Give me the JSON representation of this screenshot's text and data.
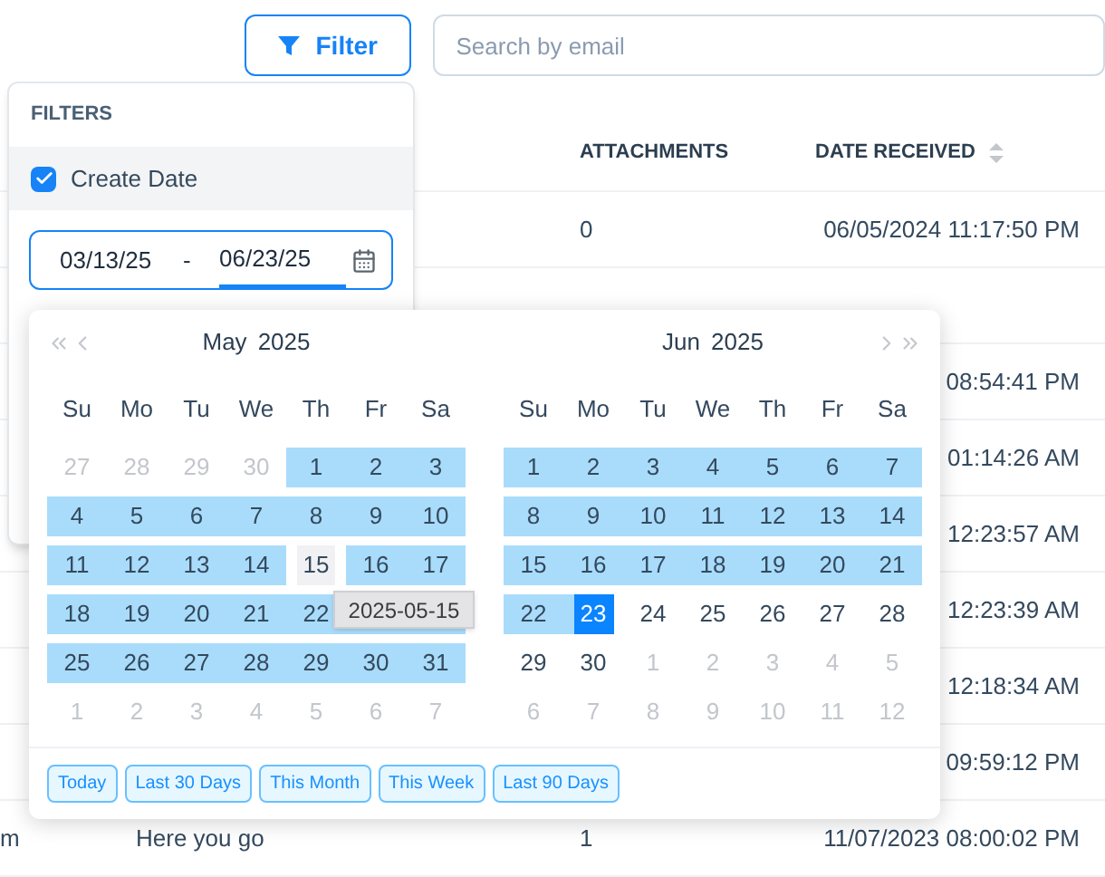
{
  "toolbar": {
    "filter_button": "Filter",
    "search": {
      "placeholder": "Search by email"
    }
  },
  "table": {
    "columns": [
      {
        "label": "ATTACHMENTS",
        "sortable": false
      },
      {
        "label": "DATE RECEIVED",
        "sortable": true
      }
    ],
    "rows": [
      {
        "attachments": "0",
        "date_received": "06/05/2024 11:17:50 PM"
      },
      {},
      {
        "date_received": "08:54:41 PM"
      },
      {
        "date_received": "01:14:26 AM"
      },
      {
        "date_received": "12:23:57 AM"
      },
      {
        "date_received": "12:23:39 AM"
      },
      {
        "date_received": "12:18:34 AM"
      },
      {
        "date_received": "09:59:12 PM"
      },
      {
        "column_1": "m",
        "column_2": "Here you go",
        "attachments": "1",
        "date_received": "11/07/2023 08:00:02 PM"
      }
    ]
  },
  "filters": {
    "title": "FILTERS",
    "options": [
      {
        "label": "Create Date",
        "checked": true
      }
    ],
    "date_range": {
      "start": "03/13/25",
      "separator": "-",
      "end": "06/23/25",
      "end_focused": true
    }
  },
  "calendar": {
    "months": [
      {
        "month": "May",
        "year": "2025",
        "weekdays": [
          "Su",
          "Mo",
          "Tu",
          "We",
          "Th",
          "Fr",
          "Sa"
        ],
        "weeks": [
          [
            {
              "day": "27",
              "kind": "outside"
            },
            {
              "day": "28",
              "kind": "outside"
            },
            {
              "day": "29",
              "kind": "outside"
            },
            {
              "day": "30",
              "kind": "outside"
            },
            {
              "day": "1",
              "kind": "range"
            },
            {
              "day": "2",
              "kind": "range"
            },
            {
              "day": "3",
              "kind": "range"
            }
          ],
          [
            {
              "day": "4",
              "kind": "range"
            },
            {
              "day": "5",
              "kind": "range"
            },
            {
              "day": "6",
              "kind": "range"
            },
            {
              "day": "7",
              "kind": "range"
            },
            {
              "day": "8",
              "kind": "range"
            },
            {
              "day": "9",
              "kind": "range"
            },
            {
              "day": "10",
              "kind": "range"
            }
          ],
          [
            {
              "day": "11",
              "kind": "range"
            },
            {
              "day": "12",
              "kind": "range"
            },
            {
              "day": "13",
              "kind": "range"
            },
            {
              "day": "14",
              "kind": "range"
            },
            {
              "day": "15",
              "kind": "hover"
            },
            {
              "day": "16",
              "kind": "range"
            },
            {
              "day": "17",
              "kind": "range"
            }
          ],
          [
            {
              "day": "18",
              "kind": "range"
            },
            {
              "day": "19",
              "kind": "range"
            },
            {
              "day": "20",
              "kind": "range"
            },
            {
              "day": "21",
              "kind": "range"
            },
            {
              "day": "22",
              "kind": "range"
            },
            {
              "kind": "range"
            },
            {
              "kind": "range"
            }
          ],
          [
            {
              "day": "25",
              "kind": "range"
            },
            {
              "day": "26",
              "kind": "range"
            },
            {
              "day": "27",
              "kind": "range"
            },
            {
              "day": "28",
              "kind": "range"
            },
            {
              "day": "29",
              "kind": "range"
            },
            {
              "day": "30",
              "kind": "range"
            },
            {
              "day": "31",
              "kind": "range"
            }
          ],
          [
            {
              "day": "1",
              "kind": "outside"
            },
            {
              "day": "2",
              "kind": "outside"
            },
            {
              "day": "3",
              "kind": "outside"
            },
            {
              "day": "4",
              "kind": "outside"
            },
            {
              "day": "5",
              "kind": "outside"
            },
            {
              "day": "6",
              "kind": "outside"
            },
            {
              "day": "7",
              "kind": "outside"
            }
          ]
        ]
      },
      {
        "month": "Jun",
        "year": "2025",
        "weekdays": [
          "Su",
          "Mo",
          "Tu",
          "We",
          "Th",
          "Fr",
          "Sa"
        ],
        "weeks": [
          [
            {
              "day": "1",
              "kind": "range"
            },
            {
              "day": "2",
              "kind": "range"
            },
            {
              "day": "3",
              "kind": "range"
            },
            {
              "day": "4",
              "kind": "range"
            },
            {
              "day": "5",
              "kind": "range"
            },
            {
              "day": "6",
              "kind": "range"
            },
            {
              "day": "7",
              "kind": "range"
            }
          ],
          [
            {
              "day": "8",
              "kind": "range"
            },
            {
              "day": "9",
              "kind": "range"
            },
            {
              "day": "10",
              "kind": "range"
            },
            {
              "day": "11",
              "kind": "range"
            },
            {
              "day": "12",
              "kind": "range"
            },
            {
              "day": "13",
              "kind": "range"
            },
            {
              "day": "14",
              "kind": "range"
            }
          ],
          [
            {
              "day": "15",
              "kind": "range"
            },
            {
              "day": "16",
              "kind": "range"
            },
            {
              "day": "17",
              "kind": "range"
            },
            {
              "day": "18",
              "kind": "range"
            },
            {
              "day": "19",
              "kind": "range"
            },
            {
              "day": "20",
              "kind": "range"
            },
            {
              "day": "21",
              "kind": "range"
            }
          ],
          [
            {
              "day": "22",
              "kind": "range"
            },
            {
              "day": "23",
              "kind": "end"
            },
            {
              "day": "24",
              "kind": "normal"
            },
            {
              "day": "25",
              "kind": "normal"
            },
            {
              "day": "26",
              "kind": "normal"
            },
            {
              "day": "27",
              "kind": "normal"
            },
            {
              "day": "28",
              "kind": "normal"
            }
          ],
          [
            {
              "day": "29",
              "kind": "normal"
            },
            {
              "day": "30",
              "kind": "normal"
            },
            {
              "day": "1",
              "kind": "outside"
            },
            {
              "day": "2",
              "kind": "outside"
            },
            {
              "day": "3",
              "kind": "outside"
            },
            {
              "day": "4",
              "kind": "outside"
            },
            {
              "day": "5",
              "kind": "outside"
            }
          ],
          [
            {
              "day": "6",
              "kind": "outside"
            },
            {
              "day": "7",
              "kind": "outside"
            },
            {
              "day": "8",
              "kind": "outside"
            },
            {
              "day": "9",
              "kind": "outside"
            },
            {
              "day": "10",
              "kind": "outside"
            },
            {
              "day": "11",
              "kind": "outside"
            },
            {
              "day": "12",
              "kind": "outside"
            }
          ]
        ]
      }
    ],
    "tooltip": "2025-05-15",
    "presets": [
      "Today",
      "Last 30 Days",
      "This Month",
      "This Week",
      "Last 90 Days"
    ]
  }
}
